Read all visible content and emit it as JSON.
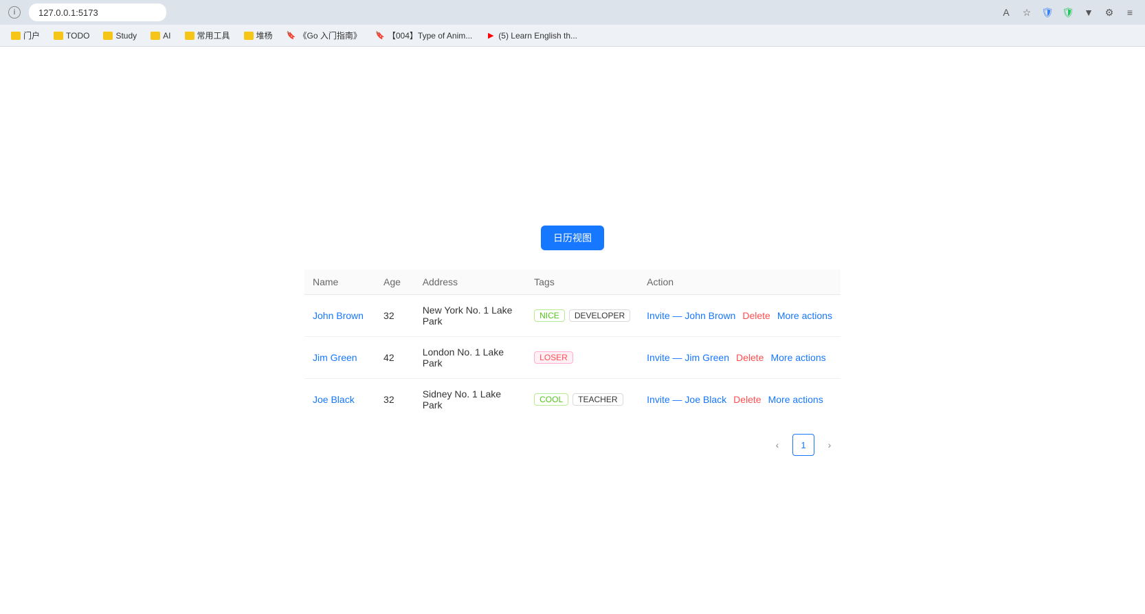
{
  "browser": {
    "url": "127.0.0.1:5173",
    "bookmarks": [
      {
        "label": "门户",
        "type": "folder",
        "color": "yellow"
      },
      {
        "label": "TODO",
        "type": "folder",
        "color": "yellow"
      },
      {
        "label": "Study",
        "type": "folder",
        "color": "yellow"
      },
      {
        "label": "AI",
        "type": "folder",
        "color": "yellow"
      },
      {
        "label": "常用工具",
        "type": "folder",
        "color": "yellow"
      },
      {
        "label": "堆杨",
        "type": "folder",
        "color": "yellow"
      },
      {
        "label": "《Go 入门指南》",
        "type": "link",
        "color": "blue"
      },
      {
        "label": "【004】Type of Anim...",
        "type": "link",
        "color": "blue"
      },
      {
        "label": "(5) Learn English th...",
        "type": "link",
        "color": "red"
      }
    ]
  },
  "page": {
    "calendar_btn": "日历视图",
    "table": {
      "columns": [
        "Name",
        "Age",
        "Address",
        "Tags",
        "Action"
      ],
      "rows": [
        {
          "name": "John Brown",
          "age": "32",
          "address": "New York No. 1 Lake Park",
          "tags": [
            "NICE",
            "DEVELOPER"
          ],
          "tag_types": [
            "nice",
            "developer"
          ],
          "invite": "Invite — John Brown",
          "delete": "Delete",
          "more": "More actions"
        },
        {
          "name": "Jim Green",
          "age": "42",
          "address": "London No. 1 Lake Park",
          "tags": [
            "LOSER"
          ],
          "tag_types": [
            "loser"
          ],
          "invite": "Invite — Jim Green",
          "delete": "Delete",
          "more": "More actions"
        },
        {
          "name": "Joe Black",
          "age": "32",
          "address": "Sidney No. 1 Lake Park",
          "tags": [
            "COOL",
            "TEACHER"
          ],
          "tag_types": [
            "cool",
            "teacher"
          ],
          "invite": "Invite — Joe Black",
          "delete": "Delete",
          "more": "More actions"
        }
      ]
    },
    "pagination": {
      "prev": "<",
      "page": "1",
      "next": ">"
    }
  }
}
